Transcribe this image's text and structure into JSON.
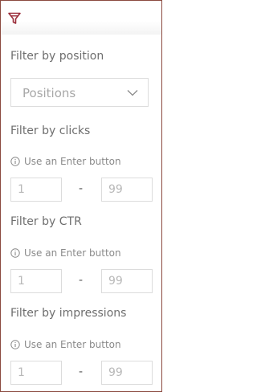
{
  "toolbar": {
    "filter_icon": "filter-icon"
  },
  "position": {
    "title": "Filter by position",
    "select_placeholder": "Positions"
  },
  "clicks": {
    "title": "Filter by clicks",
    "hint": "Use an Enter button",
    "min_placeholder": "1",
    "separator": "-",
    "max_placeholder": "99"
  },
  "ctr": {
    "title": "Filter by CTR",
    "hint": "Use an Enter button",
    "min_placeholder": "1",
    "separator": "-",
    "max_placeholder": "99"
  },
  "impressions": {
    "title": "Filter by impressions",
    "hint": "Use an Enter button",
    "min_placeholder": "1",
    "separator": "-",
    "max_placeholder": "99"
  },
  "colors": {
    "accent": "#9b2d3a",
    "border": "#8b4a3f",
    "text": "#6e6e6e"
  }
}
